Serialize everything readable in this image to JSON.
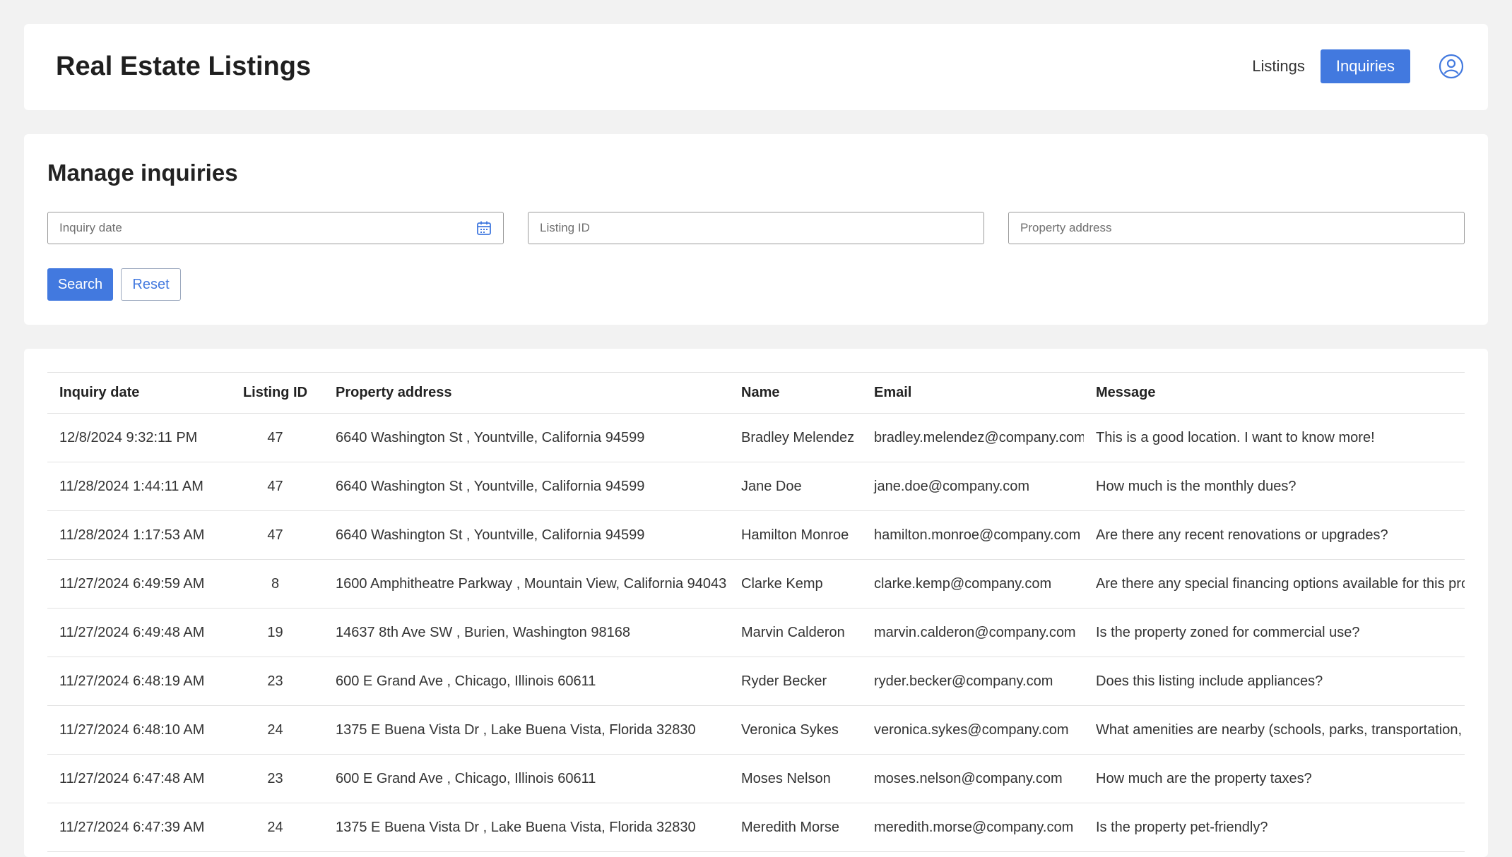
{
  "header": {
    "title": "Real Estate Listings",
    "nav": {
      "listings": "Listings",
      "inquiries": "Inquiries"
    },
    "accent": "#4279df"
  },
  "filters": {
    "title": "Manage inquiries",
    "inquiry_date_placeholder": "Inquiry date",
    "listing_id_placeholder": "Listing ID",
    "address_placeholder": "Property address",
    "search_label": "Search",
    "reset_label": "Reset"
  },
  "table": {
    "columns": [
      "Inquiry date",
      "Listing ID",
      "Property address",
      "Name",
      "Email",
      "Message"
    ],
    "rows": [
      [
        "12/8/2024 9:32:11 PM",
        "47",
        "6640 Washington St , Yountville, California 94599",
        "Bradley Melendez",
        "bradley.melendez@company.com",
        "This is a good location. I want to know more!"
      ],
      [
        "11/28/2024 1:44:11 AM",
        "47",
        "6640 Washington St , Yountville, California 94599",
        "Jane Doe",
        "jane.doe@company.com",
        "How much is the monthly dues?"
      ],
      [
        "11/28/2024 1:17:53 AM",
        "47",
        "6640 Washington St , Yountville, California 94599",
        "Hamilton Monroe",
        "hamilton.monroe@company.com",
        "Are there any recent renovations or upgrades?"
      ],
      [
        "11/27/2024 6:49:59 AM",
        "8",
        "1600 Amphitheatre Parkway , Mountain View, California 94043",
        "Clarke Kemp",
        "clarke.kemp@company.com",
        "Are there any special financing options available for this prope"
      ],
      [
        "11/27/2024 6:49:48 AM",
        "19",
        "14637 8th Ave SW , Burien, Washington 98168",
        "Marvin Calderon",
        "marvin.calderon@company.com",
        "Is the property zoned for commercial use?"
      ],
      [
        "11/27/2024 6:48:19 AM",
        "23",
        "600 E Grand Ave , Chicago, Illinois 60611",
        "Ryder Becker",
        "ryder.becker@company.com",
        "Does this listing include appliances?"
      ],
      [
        "11/27/2024 6:48:10 AM",
        "24",
        "1375 E Buena Vista Dr , Lake Buena Vista, Florida 32830",
        "Veronica Sykes",
        "veronica.sykes@company.com",
        "What amenities are nearby (schools, parks, transportation, sh"
      ],
      [
        "11/27/2024 6:47:48 AM",
        "23",
        "600 E Grand Ave , Chicago, Illinois 60611",
        "Moses Nelson",
        "moses.nelson@company.com",
        "How much are the property taxes?"
      ],
      [
        "11/27/2024 6:47:39 AM",
        "24",
        "1375 E Buena Vista Dr , Lake Buena Vista, Florida 32830",
        "Meredith Morse",
        "meredith.morse@company.com",
        "Is the property pet-friendly?"
      ]
    ]
  }
}
